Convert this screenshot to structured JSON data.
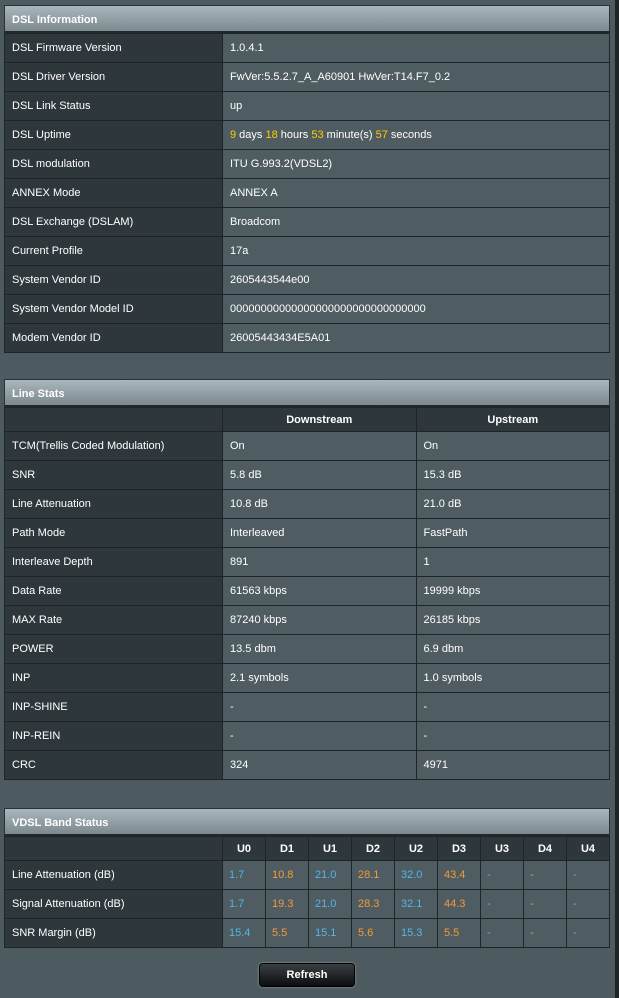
{
  "dsl_info": {
    "title": "DSL Information",
    "rows": [
      {
        "label": "DSL Firmware Version",
        "value": "1.0.4.1"
      },
      {
        "label": "DSL Driver Version",
        "value": "FwVer:5.5.2.7_A_A60901 HwVer:T14.F7_0.2"
      },
      {
        "label": "DSL Link Status",
        "value": "up"
      },
      {
        "label": "DSL Uptime",
        "days": "9",
        "days_text": " days ",
        "hours": "18",
        "hours_text": " hours ",
        "minutes": "53",
        "minutes_text": " minute(s) ",
        "seconds": "57",
        "seconds_text": " seconds"
      },
      {
        "label": "DSL modulation",
        "value": "ITU G.993.2(VDSL2)"
      },
      {
        "label": "ANNEX Mode",
        "value": "ANNEX A"
      },
      {
        "label": "DSL Exchange (DSLAM)",
        "value": "Broadcom"
      },
      {
        "label": "Current Profile",
        "value": "17a"
      },
      {
        "label": "System Vendor ID",
        "value": "2605443544e00"
      },
      {
        "label": "System Vendor Model ID",
        "value": "00000000000000000000000000000000"
      },
      {
        "label": "Modem Vendor ID",
        "value": "26005443434E5A01"
      }
    ]
  },
  "line_stats": {
    "title": "Line Stats",
    "col_down": "Downstream",
    "col_up": "Upstream",
    "rows": [
      {
        "label": "TCM(Trellis Coded Modulation)",
        "down": "On",
        "up": "On"
      },
      {
        "label": "SNR",
        "down": "5.8 dB",
        "up": "15.3 dB"
      },
      {
        "label": "Line Attenuation",
        "down": "10.8 dB",
        "up": "21.0 dB"
      },
      {
        "label": "Path Mode",
        "down": "Interleaved",
        "up": "FastPath"
      },
      {
        "label": "Interleave Depth",
        "down": "891",
        "up": "1"
      },
      {
        "label": "Data Rate",
        "down": "61563 kbps",
        "up": "19999 kbps"
      },
      {
        "label": "MAX Rate",
        "down": "87240 kbps",
        "up": "26185 kbps"
      },
      {
        "label": "POWER",
        "down": "13.5 dbm",
        "up": "6.9 dbm"
      },
      {
        "label": "INP",
        "down": "2.1 symbols",
        "up": "1.0 symbols"
      },
      {
        "label": "INP-SHINE",
        "down": "-",
        "up": "-"
      },
      {
        "label": "INP-REIN",
        "down": "-",
        "up": "-"
      },
      {
        "label": "CRC",
        "down": "324",
        "up": "4971"
      }
    ]
  },
  "band_status": {
    "title": "VDSL Band Status",
    "bands": [
      "U0",
      "D1",
      "U1",
      "D2",
      "U2",
      "D3",
      "U3",
      "D4",
      "U4"
    ],
    "colors": {
      "up": "#4fb8e8",
      "down": "#f59a3a"
    },
    "rows": [
      {
        "label": "Line Attenuation (dB)",
        "values": [
          "1.7",
          "10.8",
          "21.0",
          "28.1",
          "32.0",
          "43.4",
          "-",
          "-",
          "-"
        ]
      },
      {
        "label": "Signal Attenuation (dB)",
        "values": [
          "1.7",
          "19.3",
          "21.0",
          "28.3",
          "32.1",
          "44.3",
          "-",
          "-",
          "-"
        ]
      },
      {
        "label": "SNR Margin (dB)",
        "values": [
          "15.4",
          "5.5",
          "15.1",
          "5.6",
          "15.3",
          "5.5",
          "-",
          "-",
          "-"
        ]
      }
    ]
  },
  "refresh_label": "Refresh"
}
